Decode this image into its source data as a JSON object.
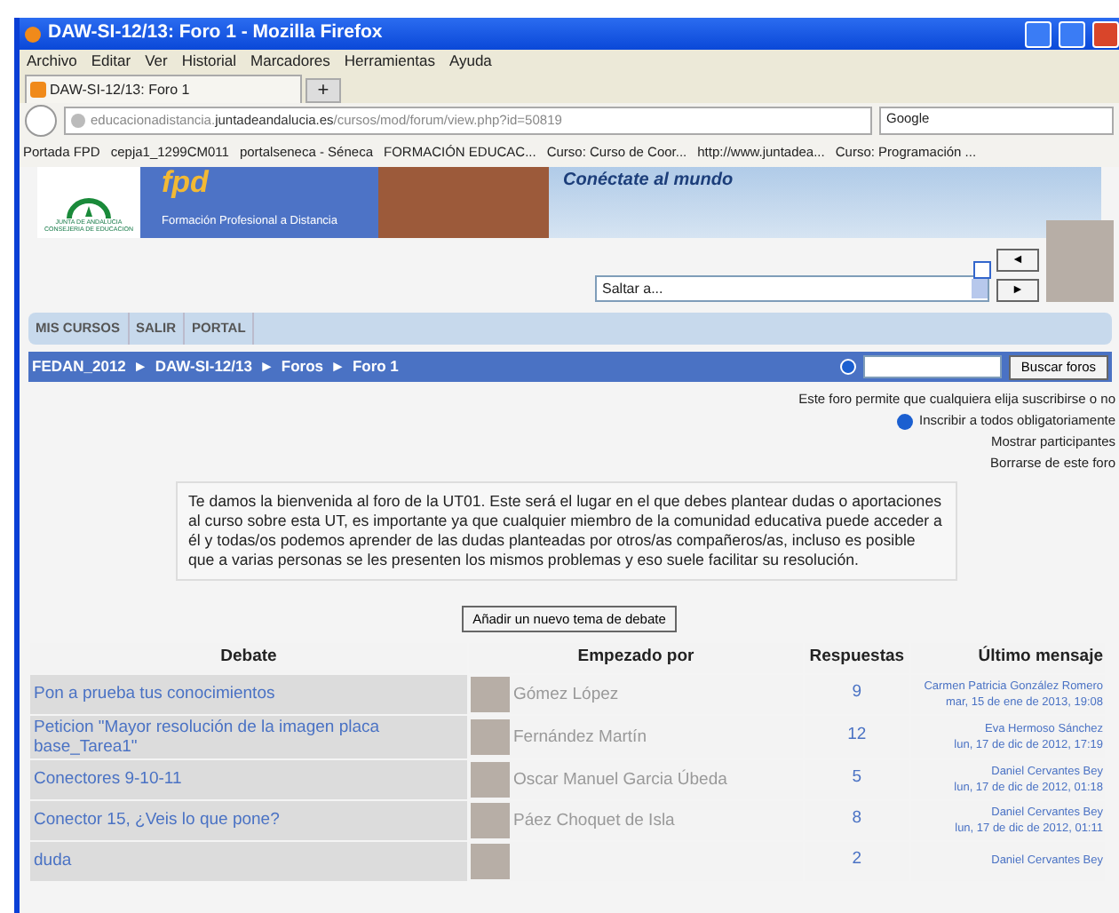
{
  "window": {
    "title": "DAW-SI-12/13: Foro 1 - Mozilla Firefox"
  },
  "menu_bar": [
    "Archivo",
    "Editar",
    "Ver",
    "Historial",
    "Marcadores",
    "Herramientas",
    "Ayuda"
  ],
  "tabs": [
    {
      "label": "DAW-SI-12/13: Foro 1",
      "selected": true
    }
  ],
  "new_tab": "+",
  "address_bar": {
    "url": "educacionadistancia.**juntadeandalucia.es**/cursos/mod/forum/view.php?id=50819"
  },
  "search_engine": {
    "placeholder": "Google"
  },
  "bookmarks": [
    "Portada FPD",
    "cepja1_1299CM011",
    "portalseneca - Séneca",
    "FORMACIÓN EDUCAC...",
    "Curso: Curso de Coor...",
    "http://www.juntadea...",
    "Curso: Programación ..."
  ],
  "banner": {
    "logo_line_1": "JUNTA DE ANDALUCIA",
    "logo_line_2": "CONSEJERIA DE EDUCACION",
    "brand": "fpd",
    "program": "Formación Profesional a Distancia",
    "slogan": "Conéctate al mundo"
  },
  "jump_menu": {
    "value": "Saltar a...",
    "prev": "◄",
    "next": "►"
  },
  "course_menu": [
    "MIS CURSOS",
    "SALIR",
    "PORTAL"
  ],
  "breadcrumb": {
    "items": [
      "FEDAN_2012",
      "DAW-SI-12/13",
      "Foros",
      "Foro 1"
    ],
    "separator": "►"
  },
  "forum_search": {
    "button": "Buscar foros"
  },
  "subscription": {
    "note": "Este foro permite que cualquiera elija suscribirse o no",
    "links": [
      "Inscribir a todos obligatoriamente",
      "Mostrar participantes",
      "Borrarse de este foro"
    ]
  },
  "intro": "Te damos la bienvenida al foro de la UT01. Este será el lugar en el que debes plantear dudas o aportaciones al curso sobre esta UT, es importante ya que cualquier miembro de la comunidad educativa puede acceder a él y todas/os podemos aprender de las dudas planteadas por otros/as compañeros/as, incluso es posible que a varias personas se les presenten los mismos problemas y eso suele facilitar su resolución.",
  "add_button": "Añadir un nuevo tema de debate",
  "table": {
    "columns": [
      "Debate",
      "Empezado por",
      "Respuestas",
      "Último mensaje"
    ],
    "rows": [
      {
        "debate": "Pon a prueba tus conocimientos",
        "author": "Gómez López",
        "replies": "9",
        "last_author": "Carmen Patricia González Romero",
        "last_date": "mar, 15 de ene de 2013, 19:08"
      },
      {
        "debate": "Peticion \"Mayor resolución de la imagen placa base_Tarea1\"",
        "author": "Fernández Martín",
        "replies": "12",
        "last_author": "Eva Hermoso Sánchez",
        "last_date": "lun, 17 de dic de 2012, 17:19"
      },
      {
        "debate": "Conectores 9-10-11",
        "author": "Oscar Manuel Garcia Úbeda",
        "replies": "5",
        "last_author": "Daniel Cervantes Bey",
        "last_date": "lun, 17 de dic de 2012, 01:18"
      },
      {
        "debate": "Conector 15, ¿Veis lo que pone?",
        "author": "Páez Choquet de Isla",
        "replies": "8",
        "last_author": "Daniel Cervantes Bey",
        "last_date": "lun, 17 de dic de 2012, 01:11"
      },
      {
        "debate": "duda",
        "author": "",
        "replies": "2",
        "last_author": "Daniel Cervantes Bey",
        "last_date": ""
      }
    ]
  }
}
